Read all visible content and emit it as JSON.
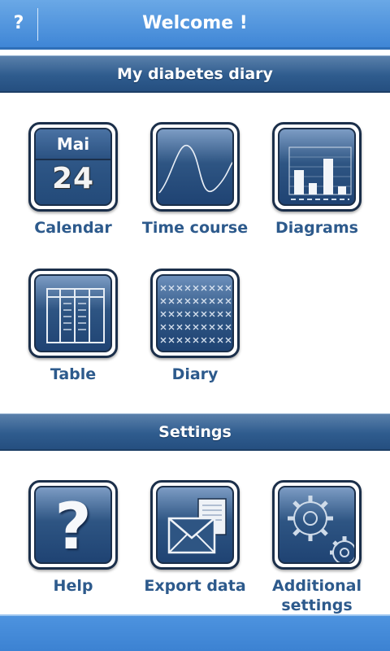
{
  "topbar": {
    "help_label": "?",
    "title": "Welcome !"
  },
  "sections": {
    "diary": "My diabetes diary",
    "settings": "Settings"
  },
  "tiles": {
    "calendar": {
      "label": "Calendar",
      "month": "Mai",
      "day": "24"
    },
    "time_course": {
      "label": "Time course"
    },
    "diagrams": {
      "label": "Diagrams"
    },
    "table": {
      "label": "Table"
    },
    "diary": {
      "label": "Diary"
    },
    "help": {
      "label": "Help"
    },
    "export": {
      "label": "Export data"
    },
    "additional": {
      "label_line1": "Additional",
      "label_line2": "settings"
    }
  },
  "colors": {
    "topbar": "#4a90dc",
    "section_header": "#2f5c8e",
    "label_text": "#2d5a8c",
    "bottombar": "#4189d6"
  }
}
